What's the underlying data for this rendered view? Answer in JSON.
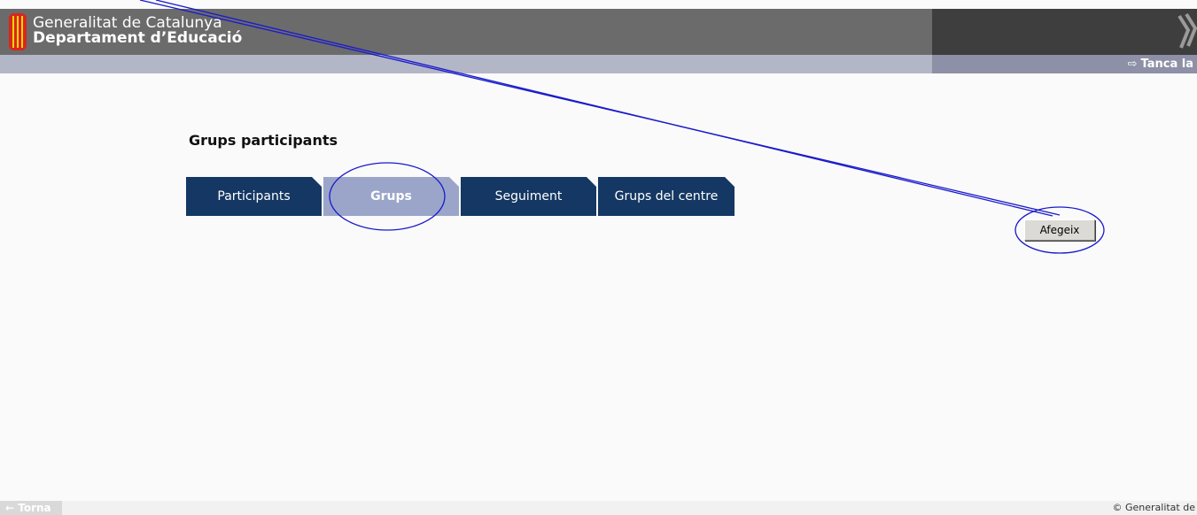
{
  "header": {
    "org_line1": "Generalitat de Catalunya",
    "org_line2": "Departament d’Educació",
    "close_label": "Tanca la",
    "close_icon": "exit-arrow-icon"
  },
  "page": {
    "title": "Grups participants"
  },
  "tabs": [
    {
      "label": "Participants",
      "active": false
    },
    {
      "label": "Grups",
      "active": true
    },
    {
      "label": "Seguiment",
      "active": false
    },
    {
      "label": "Grups del centre",
      "active": false
    }
  ],
  "actions": {
    "add_label": "Afegeix"
  },
  "footer": {
    "back_label": "← Torna",
    "copyright": "© Generalitat de"
  },
  "colors": {
    "tab_inactive": "#143763",
    "tab_active": "#9ba5c9",
    "header_bg": "#6b6b6b",
    "subbar_bg": "#b3b6c6",
    "annotation": "#1a1acc"
  }
}
